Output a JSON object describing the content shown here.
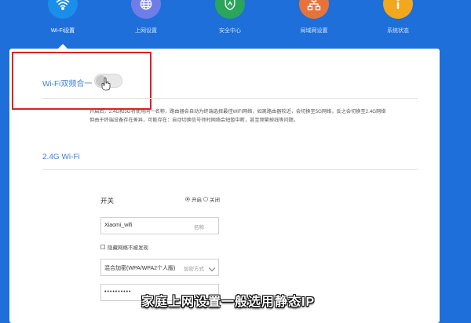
{
  "nav": {
    "items": [
      {
        "label": "Wi-Fi设置",
        "icon": "wifi-icon",
        "color": "#1a8ee8",
        "active": true
      },
      {
        "label": "上网设置",
        "icon": "globe-icon",
        "color": "#6f7de8",
        "active": false
      },
      {
        "label": "安全中心",
        "icon": "shield-icon",
        "color": "#2aa55a",
        "active": false
      },
      {
        "label": "局域网设置",
        "icon": "lan-icon",
        "color": "#e8733a",
        "active": false
      },
      {
        "label": "系统状态",
        "icon": "info-icon",
        "color": "#f2a81e",
        "active": false
      }
    ]
  },
  "dual_band": {
    "label": "Wi-Fi双频合一",
    "enabled": false
  },
  "description": {
    "line1": "开启后，2.4G和5G将使用同一名称，路由器会自动为终端选择最佳WiFi网络，如离路由器较近，会切换至5G网络，反之会切换至2.4G网络",
    "line2": "但由于终端设备存在差异，可能存在：自动切换信号师时网络会短暂中断，甚至频繁掉线等问题。"
  },
  "wifi24": {
    "title": "2.4G Wi-Fi",
    "switch_label": "开关",
    "radio_on": "开启",
    "radio_off": "关闭",
    "ssid_value": "Xiaomi_wifi",
    "ssid_suffix": "名称",
    "hide_label": "隐藏网络不被发现",
    "encryption_value": "混合加密(WPA/WPA2个人版)",
    "encryption_suffix": "加密方式",
    "password_value": "••••••••••"
  },
  "caption": "家庭上网设置一般选用静态IP"
}
